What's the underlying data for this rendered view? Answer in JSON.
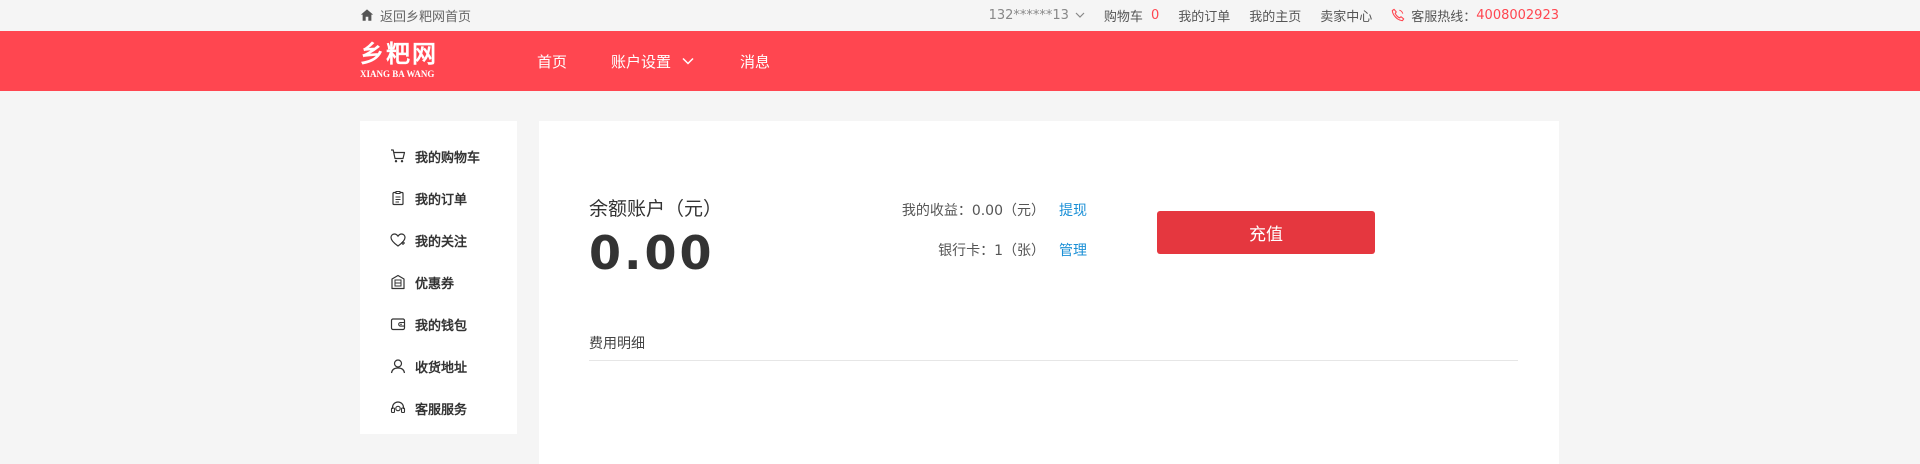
{
  "topbar": {
    "back_label": "返回乡粑网首页",
    "user": "132******13",
    "cart_label": "购物车",
    "cart_count": "0",
    "my_orders": "我的订单",
    "my_home": "我的主页",
    "seller_center": "卖家中心",
    "hotline_label": "客服热线：",
    "hotline_number": "4008002923"
  },
  "header": {
    "logo_cn": "乡粑网",
    "logo_en": "XIANG BA WANG",
    "nav": [
      "首页",
      "账户设置",
      "消息"
    ]
  },
  "sidebar": {
    "items": [
      {
        "label": "我的购物车",
        "icon": "cart-icon"
      },
      {
        "label": "我的订单",
        "icon": "order-icon"
      },
      {
        "label": "我的关注",
        "icon": "heart-icon"
      },
      {
        "label": "优惠券",
        "icon": "coupon-icon"
      },
      {
        "label": "我的钱包",
        "icon": "wallet-icon"
      },
      {
        "label": "收货地址",
        "icon": "address-icon"
      },
      {
        "label": "客服服务",
        "icon": "headset-icon"
      }
    ]
  },
  "main": {
    "balance_label": "余额账户（元）",
    "balance_value": "0.00",
    "income_label": "我的收益：0.00（元）",
    "income_link": "提现",
    "bank_label": "银行卡：1（张）",
    "bank_link": "管理",
    "recharge_label": "充值",
    "detail_title": "费用明细"
  },
  "colors": {
    "brand_red": "#ff4650",
    "button_red": "#e5373f",
    "link_blue": "#1a8fd6"
  }
}
